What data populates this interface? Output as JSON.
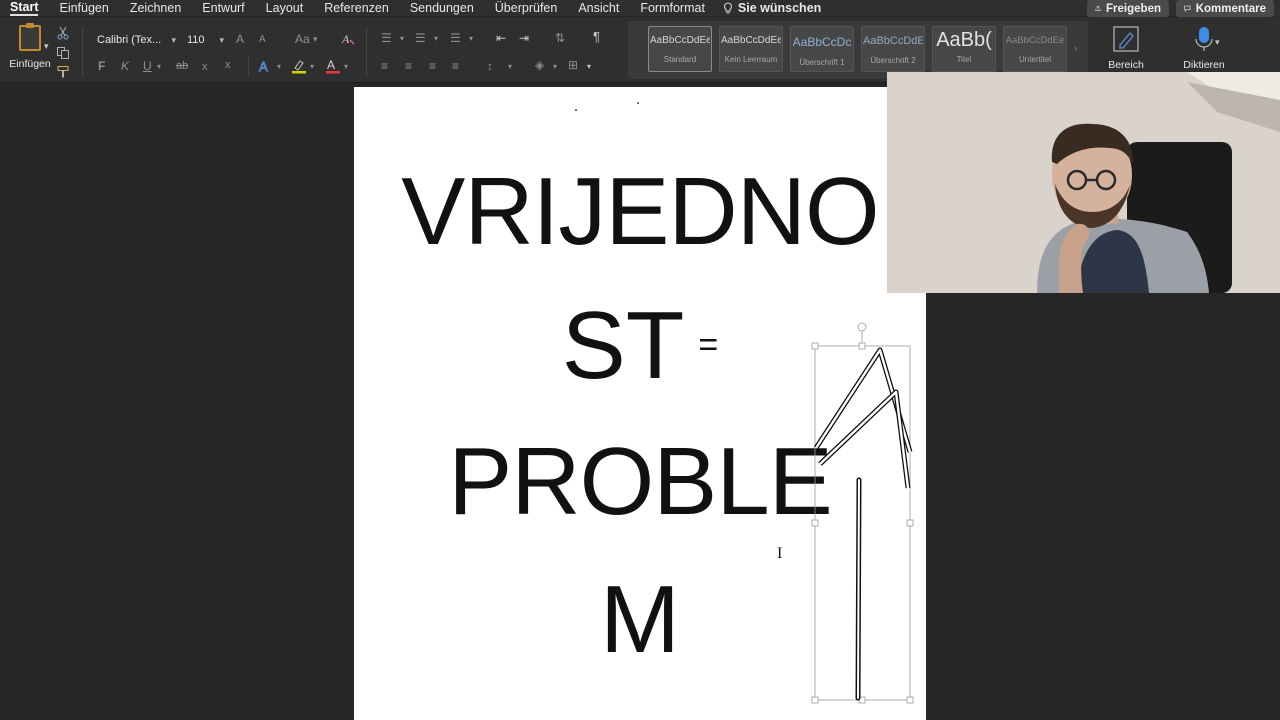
{
  "ribbon_tabs": [
    {
      "label": "Start",
      "active": true
    },
    {
      "label": "Einfügen"
    },
    {
      "label": "Zeichnen"
    },
    {
      "label": "Entwurf"
    },
    {
      "label": "Layout"
    },
    {
      "label": "Referenzen"
    },
    {
      "label": "Sendungen"
    },
    {
      "label": "Überprüfen"
    },
    {
      "label": "Ansicht"
    },
    {
      "label": "Formformat"
    }
  ],
  "help": {
    "label": "Sie wünschen"
  },
  "share": {
    "label": "Freigeben"
  },
  "comments": {
    "label": "Kommentare"
  },
  "clipboard": {
    "paste_label": "Einfügen"
  },
  "font": {
    "name": "Calibri (Tex...",
    "size": "110"
  },
  "format_icons": {
    "bold": "F",
    "italic": "K",
    "underline": "U",
    "strike": "ab",
    "subscript": "x",
    "superscript": "x",
    "grow": "A",
    "shrink": "A",
    "case": "Aa"
  },
  "styles": [
    {
      "preview": "AaBbCcDdEe",
      "name": "Standard",
      "selected": true
    },
    {
      "preview": "AaBbCcDdEe",
      "name": "Kein Leerraum"
    },
    {
      "preview": "AaBbCcDc",
      "name": "Überschrift 1"
    },
    {
      "preview": "AaBbCcDdEe",
      "name": "Überschrift 2"
    },
    {
      "preview": "AaBb(",
      "name": "Titel"
    },
    {
      "preview": "AaBbCcDdEe",
      "name": "Untertitel"
    }
  ],
  "bereich": {
    "label": "Bereich"
  },
  "diktieren": {
    "label": "Diktieren"
  },
  "document": {
    "line1": "VRIJEDNO",
    "line2": "ST",
    "line2_symbol": "=",
    "line3": "PROBLE",
    "line4": "M"
  },
  "colors": {
    "ribbon_bg": "#2f2f2f",
    "workspace_bg": "#262626",
    "page_bg": "#ffffff",
    "font_color_red": "#e03b3b",
    "highlight_yellow": "#d8d000",
    "diktieren_blue": "#3a8ee6"
  },
  "icons": [
    "cut-icon",
    "copy-icon",
    "format-painter-icon",
    "lightbulb-icon",
    "share-icon",
    "comment-icon",
    "paragraph-mark-icon",
    "microphone-icon",
    "styles-pane-icon"
  ]
}
